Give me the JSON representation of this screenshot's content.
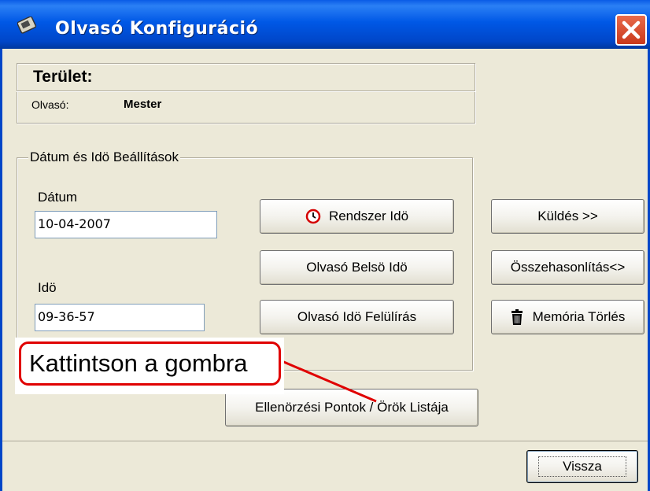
{
  "window": {
    "title": "Olvasó Konfiguráció",
    "close_icon": "close-icon",
    "app_icon": "app-icon"
  },
  "area": {
    "heading": "Terület:",
    "reader_label": "Olvasó:",
    "reader_value": "Mester"
  },
  "datetime": {
    "legend": "Dátum és Idö Beállítások",
    "date_label": "Dátum",
    "date_value": "10-04-2007",
    "time_label": "Idö",
    "time_value": "09-36-57",
    "system_time_button": "Rendszer Idö",
    "system_time_icon": "clock-icon",
    "reader_internal_time_button": "Olvasó Belsö Idö",
    "reader_time_overwrite_button": "Olvasó Idö Felülírás"
  },
  "side_buttons": {
    "send": "Küldés >>",
    "compare": "Összehasonlítás<>",
    "memory_clear": "Memória Törlés",
    "memory_clear_icon": "trash-icon"
  },
  "checkpoints_button": "Ellenörzési Pontok / Örök Listája",
  "callout": {
    "text": "Kattintson a gombra",
    "color": "#E00000"
  },
  "footer": {
    "back_button": "Vissza"
  },
  "colors": {
    "titlebar": "#0058E6",
    "window_bg": "#ECE9D8",
    "close": "#C9381B"
  }
}
